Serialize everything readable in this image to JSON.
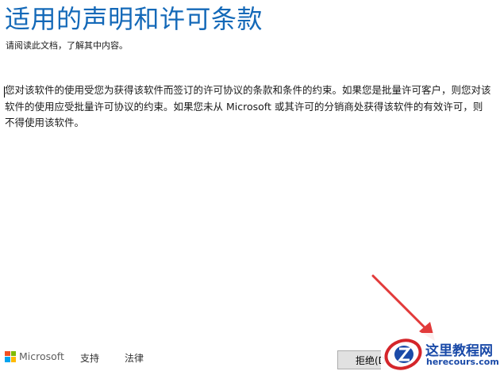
{
  "header": {
    "title": "适用的声明和许可条款",
    "subtitle": "请阅读此文档，了解其中内容。"
  },
  "license": {
    "text": "您对该软件的使用受您为获得该软件而签订的许可协议的条款和条件的约束。如果您是批量许可客户，则您对该软件的使用应受批量许可协议的约束。如果您未从 Microsoft 或其许可的分销商处获得该软件的有效许可，则不得使用该软件。"
  },
  "footer": {
    "brand": "Microsoft",
    "links": [
      "支持",
      "法律"
    ],
    "decline_button": "拒绝(D"
  },
  "watermark": {
    "title": "这里教程网",
    "url": "herecours.com"
  },
  "colors": {
    "title": "#1469b8",
    "arrow": "#e23a3a",
    "ms_red": "#f25022",
    "ms_green": "#7fba00",
    "ms_blue": "#00a4ef",
    "ms_yellow": "#ffb900"
  },
  "icons": [
    "microsoft-logo-icon",
    "red-arrow-icon",
    "watermark-logo-icon"
  ]
}
